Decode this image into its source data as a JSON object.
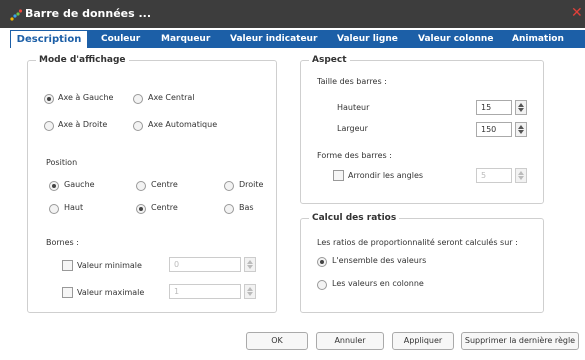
{
  "window": {
    "title": "Barre de données ...",
    "close_glyph": "✕",
    "icon": "dot-chart-icon"
  },
  "tabs": [
    {
      "label": "Description",
      "active": true
    },
    {
      "label": "Couleur"
    },
    {
      "label": "Marqueur"
    },
    {
      "label": "Valeur indicateur"
    },
    {
      "label": "Valeur ligne"
    },
    {
      "label": "Valeur colonne"
    },
    {
      "label": "Animation"
    }
  ],
  "display_mode": {
    "legend": "Mode d'affichage",
    "axis_options": [
      {
        "label": "Axe à Gauche",
        "selected": true
      },
      {
        "label": "Axe Central",
        "selected": false
      },
      {
        "label": "Axe à Droite",
        "selected": false
      },
      {
        "label": "Axe Automatique",
        "selected": false
      }
    ],
    "position_label": "Position",
    "position_options": [
      {
        "label": "Gauche",
        "selected": true
      },
      {
        "label": "Centre",
        "selected": false
      },
      {
        "label": "Droite",
        "selected": false
      },
      {
        "label": "Haut",
        "selected": false
      },
      {
        "label": "Centre",
        "selected": true
      },
      {
        "label": "Bas",
        "selected": false
      }
    ],
    "bounds_label": "Bornes :",
    "min": {
      "label": "Valeur minimale",
      "checked": false,
      "value": "0"
    },
    "max": {
      "label": "Valeur maximale",
      "checked": false,
      "value": "1"
    }
  },
  "aspect": {
    "legend": "Aspect",
    "size_label": "Taille des barres :",
    "height_label": "Hauteur",
    "height_value": "15",
    "width_label": "Largeur",
    "width_value": "150",
    "shape_label": "Forme des barres :",
    "round_label": "Arrondir les angles",
    "round_checked": false,
    "round_value": "5"
  },
  "ratios": {
    "legend": "Calcul des ratios",
    "description": "Les ratios de proportionnalité seront calculés sur :",
    "options": [
      {
        "label": "L'ensemble des valeurs",
        "selected": true
      },
      {
        "label": "Les valeurs en colonne",
        "selected": false
      }
    ]
  },
  "buttons": {
    "ok": "OK",
    "cancel": "Annuler",
    "apply": "Appliquer",
    "delete_last_rule": "Supprimer la dernière règle"
  },
  "colors": {
    "tab_bar": "#1c5fa7",
    "title_bar": "#3d3d3d",
    "close": "#e0403a"
  }
}
